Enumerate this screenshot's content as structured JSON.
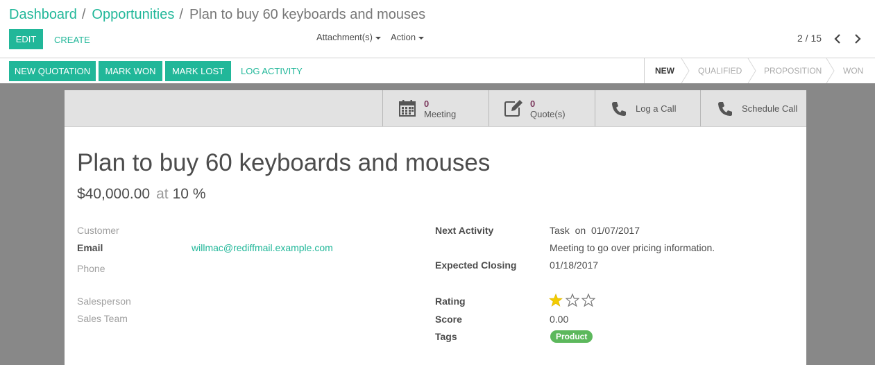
{
  "breadcrumb": {
    "items": [
      "Dashboard",
      "Opportunities"
    ],
    "current": "Plan to buy 60 keyboards and mouses"
  },
  "toolbar": {
    "edit_label": "EDIT",
    "create_label": "CREATE",
    "attachments_label": "Attachment(s)",
    "action_label": "Action",
    "pager": "2 / 15"
  },
  "statusbar": {
    "buttons": {
      "new_quotation": "NEW QUOTATION",
      "mark_won": "MARK WON",
      "mark_lost": "MARK LOST",
      "log_activity": "LOG ACTIVITY"
    },
    "stages": [
      "NEW",
      "QUALIFIED",
      "PROPOSITION",
      "WON"
    ],
    "active_stage": "NEW"
  },
  "smart_buttons": {
    "meeting": {
      "count": "0",
      "label": "Meeting",
      "icon": "calendar-icon"
    },
    "quotes": {
      "count": "0",
      "label": "Quote(s)",
      "icon": "edit-icon"
    },
    "log_call": {
      "label": "Log a Call",
      "icon": "phone-icon"
    },
    "schedule_call": {
      "label": "Schedule Call",
      "icon": "phone-icon"
    }
  },
  "record": {
    "title": "Plan to buy 60 keyboards and mouses",
    "revenue": "$40,000.00",
    "at_label": "at",
    "probability": "10 %"
  },
  "left_fields": {
    "customer_label": "Customer",
    "email_label": "Email",
    "email_value": "willmac@rediffmail.example.com",
    "phone_label": "Phone",
    "salesperson_label": "Salesperson",
    "sales_team_label": "Sales Team"
  },
  "right_fields": {
    "next_activity_label": "Next Activity",
    "next_activity_type": "Task",
    "on_label": "on",
    "next_activity_date": "01/07/2017",
    "next_activity_summary": "Meeting to go over pricing information.",
    "expected_closing_label": "Expected Closing",
    "expected_closing_value": "01/18/2017",
    "rating_label": "Rating",
    "rating": 1,
    "rating_max": 3,
    "score_label": "Score",
    "score_value": "0.00",
    "tags_label": "Tags",
    "tags": [
      "Product"
    ]
  },
  "colors": {
    "primary": "#21b799",
    "star": "#f3cc00",
    "tag": "#5cb85c",
    "backdrop": "#888888"
  }
}
